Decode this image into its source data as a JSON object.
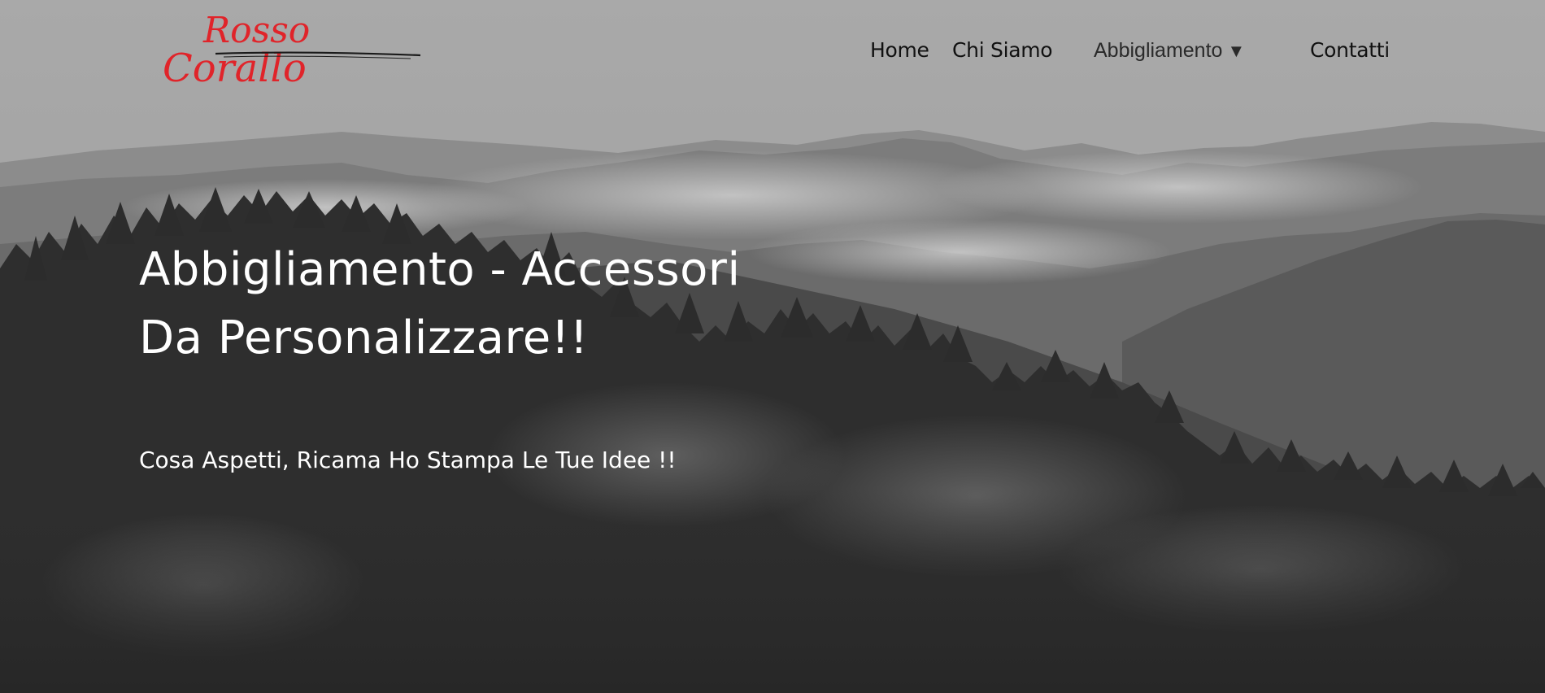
{
  "brand": {
    "logo_line1": "Rosso",
    "logo_line2": "Corallo",
    "logo_color": "#e0242a"
  },
  "nav": {
    "items": [
      {
        "label": "Home"
      },
      {
        "label": "Chi Siamo"
      },
      {
        "label": "Abbigliamento",
        "icon": "caret-down-icon",
        "caret": "▼"
      },
      {
        "label": "Contatti"
      }
    ]
  },
  "hero": {
    "title_line1": "Abbigliamento - Accessori",
    "title_line2": "Da Personalizzare!!",
    "subtitle": "Cosa Aspetti, Ricama Ho Stampa Le Tue Idee !!"
  },
  "colors": {
    "sky": "#a7a7a7",
    "forest": "#2a2a2a",
    "text": "#ffffff",
    "nav_text": "#111111"
  }
}
